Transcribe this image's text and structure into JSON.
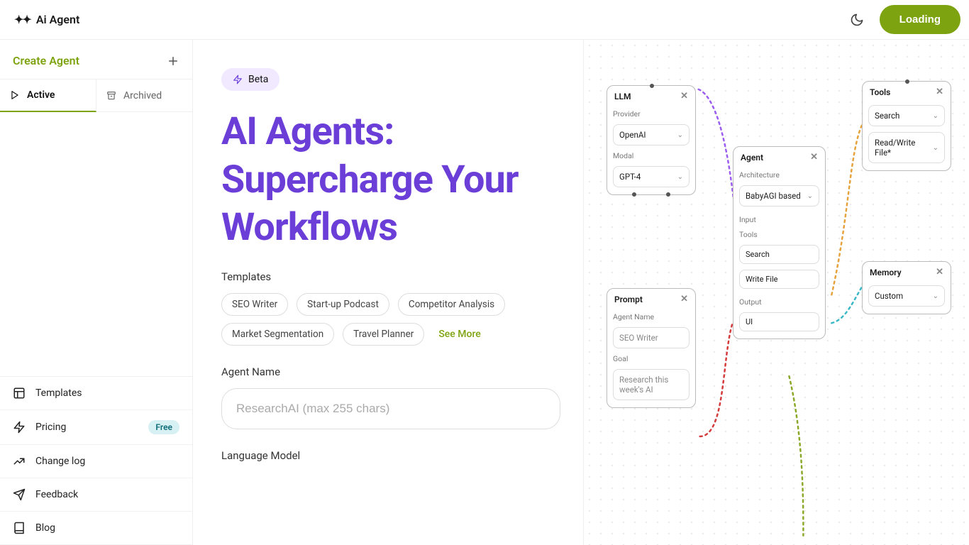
{
  "header": {
    "brand": "Ai Agent",
    "loading_button": "Loading"
  },
  "sidebar": {
    "create_label": "Create Agent",
    "tabs": {
      "active": "Active",
      "archived": "Archived"
    },
    "nav": {
      "templates": "Templates",
      "pricing": "Pricing",
      "pricing_badge": "Free",
      "changelog": "Change log",
      "feedback": "Feedback",
      "blog": "Blog"
    }
  },
  "main": {
    "beta_label": "Beta",
    "title": "AI Agents: Supercharge Your Workflows",
    "templates_label": "Templates",
    "template_chips": {
      "seo_writer": "SEO Writer",
      "startup_podcast": "Start-up Podcast",
      "competitor_analysis": "Competitor Analysis",
      "market_segmentation": "Market Segmentation",
      "travel_planner": "Travel Planner"
    },
    "see_more": "See More",
    "agent_name_label": "Agent Name",
    "agent_name_placeholder": "ResearchAI (max 255 chars)",
    "language_model_label": "Language Model"
  },
  "canvas": {
    "llm": {
      "title": "LLM",
      "provider_label": "Provider",
      "provider_value": "OpenAI",
      "model_label": "Modal",
      "model_value": "GPT-4"
    },
    "prompt": {
      "title": "Prompt",
      "agent_name_label": "Agent Name",
      "agent_name_value": "SEO Writer",
      "goal_label": "Goal",
      "goal_value": "Research this week's AI"
    },
    "agent": {
      "title": "Agent",
      "architecture_label": "Architecture",
      "architecture_value": "BabyAGI based",
      "input_label": "Input",
      "tools_label": "Tools",
      "tool_search": "Search",
      "tool_writefile": "Write File",
      "output_label": "Output",
      "output_value": "UI"
    },
    "tools": {
      "title": "Tools",
      "search": "Search",
      "readwrite": "Read/Write File*"
    },
    "memory": {
      "title": "Memory",
      "value": "Custom"
    }
  }
}
